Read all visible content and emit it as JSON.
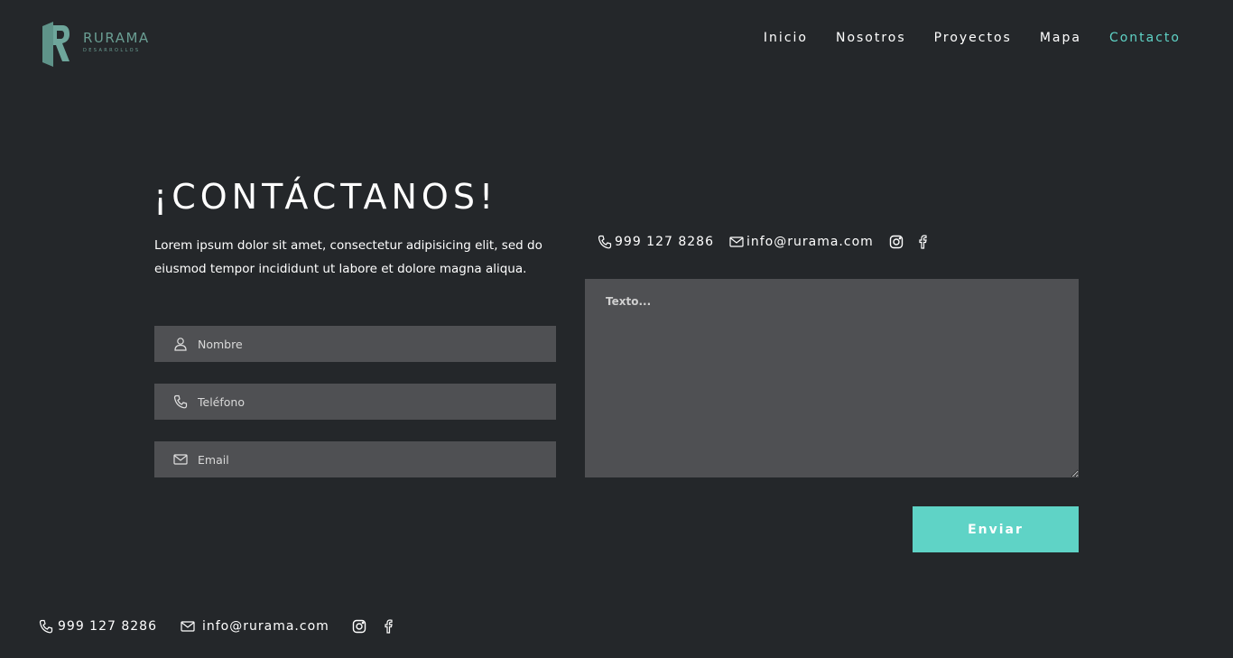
{
  "brand": {
    "name": "RURAMA",
    "tagline": "DESARROLLOS",
    "color": "#6a9e93"
  },
  "nav": {
    "items": [
      {
        "label": "Inicio"
      },
      {
        "label": "Nosotros"
      },
      {
        "label": "Proyectos"
      },
      {
        "label": "Mapa"
      },
      {
        "label": "Contacto",
        "active": true
      }
    ],
    "active_color": "#5fd3c6"
  },
  "contact_section": {
    "title": "¡CONTÁCTANOS!",
    "intro": "Lorem ipsum dolor sit amet, consectetur adipisicing elit, sed do eiusmod tempor incididunt ut labore et dolore magna aliqua.",
    "fields": {
      "name_placeholder": "Nombre",
      "phone_placeholder": "Teléfono",
      "email_placeholder": "Email",
      "message_placeholder": "Texto..."
    },
    "send_label": "Enviar",
    "phone": "999 127 8286",
    "email": "info@rurama.com"
  },
  "footer": {
    "phone": "999 127 8286",
    "email": "info@rurama.com"
  },
  "colors": {
    "background": "#24272a",
    "input_bg": "#4f5053",
    "accent": "#5fd3c6"
  },
  "icons": [
    "user-icon",
    "phone-icon",
    "mail-icon",
    "instagram-icon",
    "facebook-icon"
  ]
}
